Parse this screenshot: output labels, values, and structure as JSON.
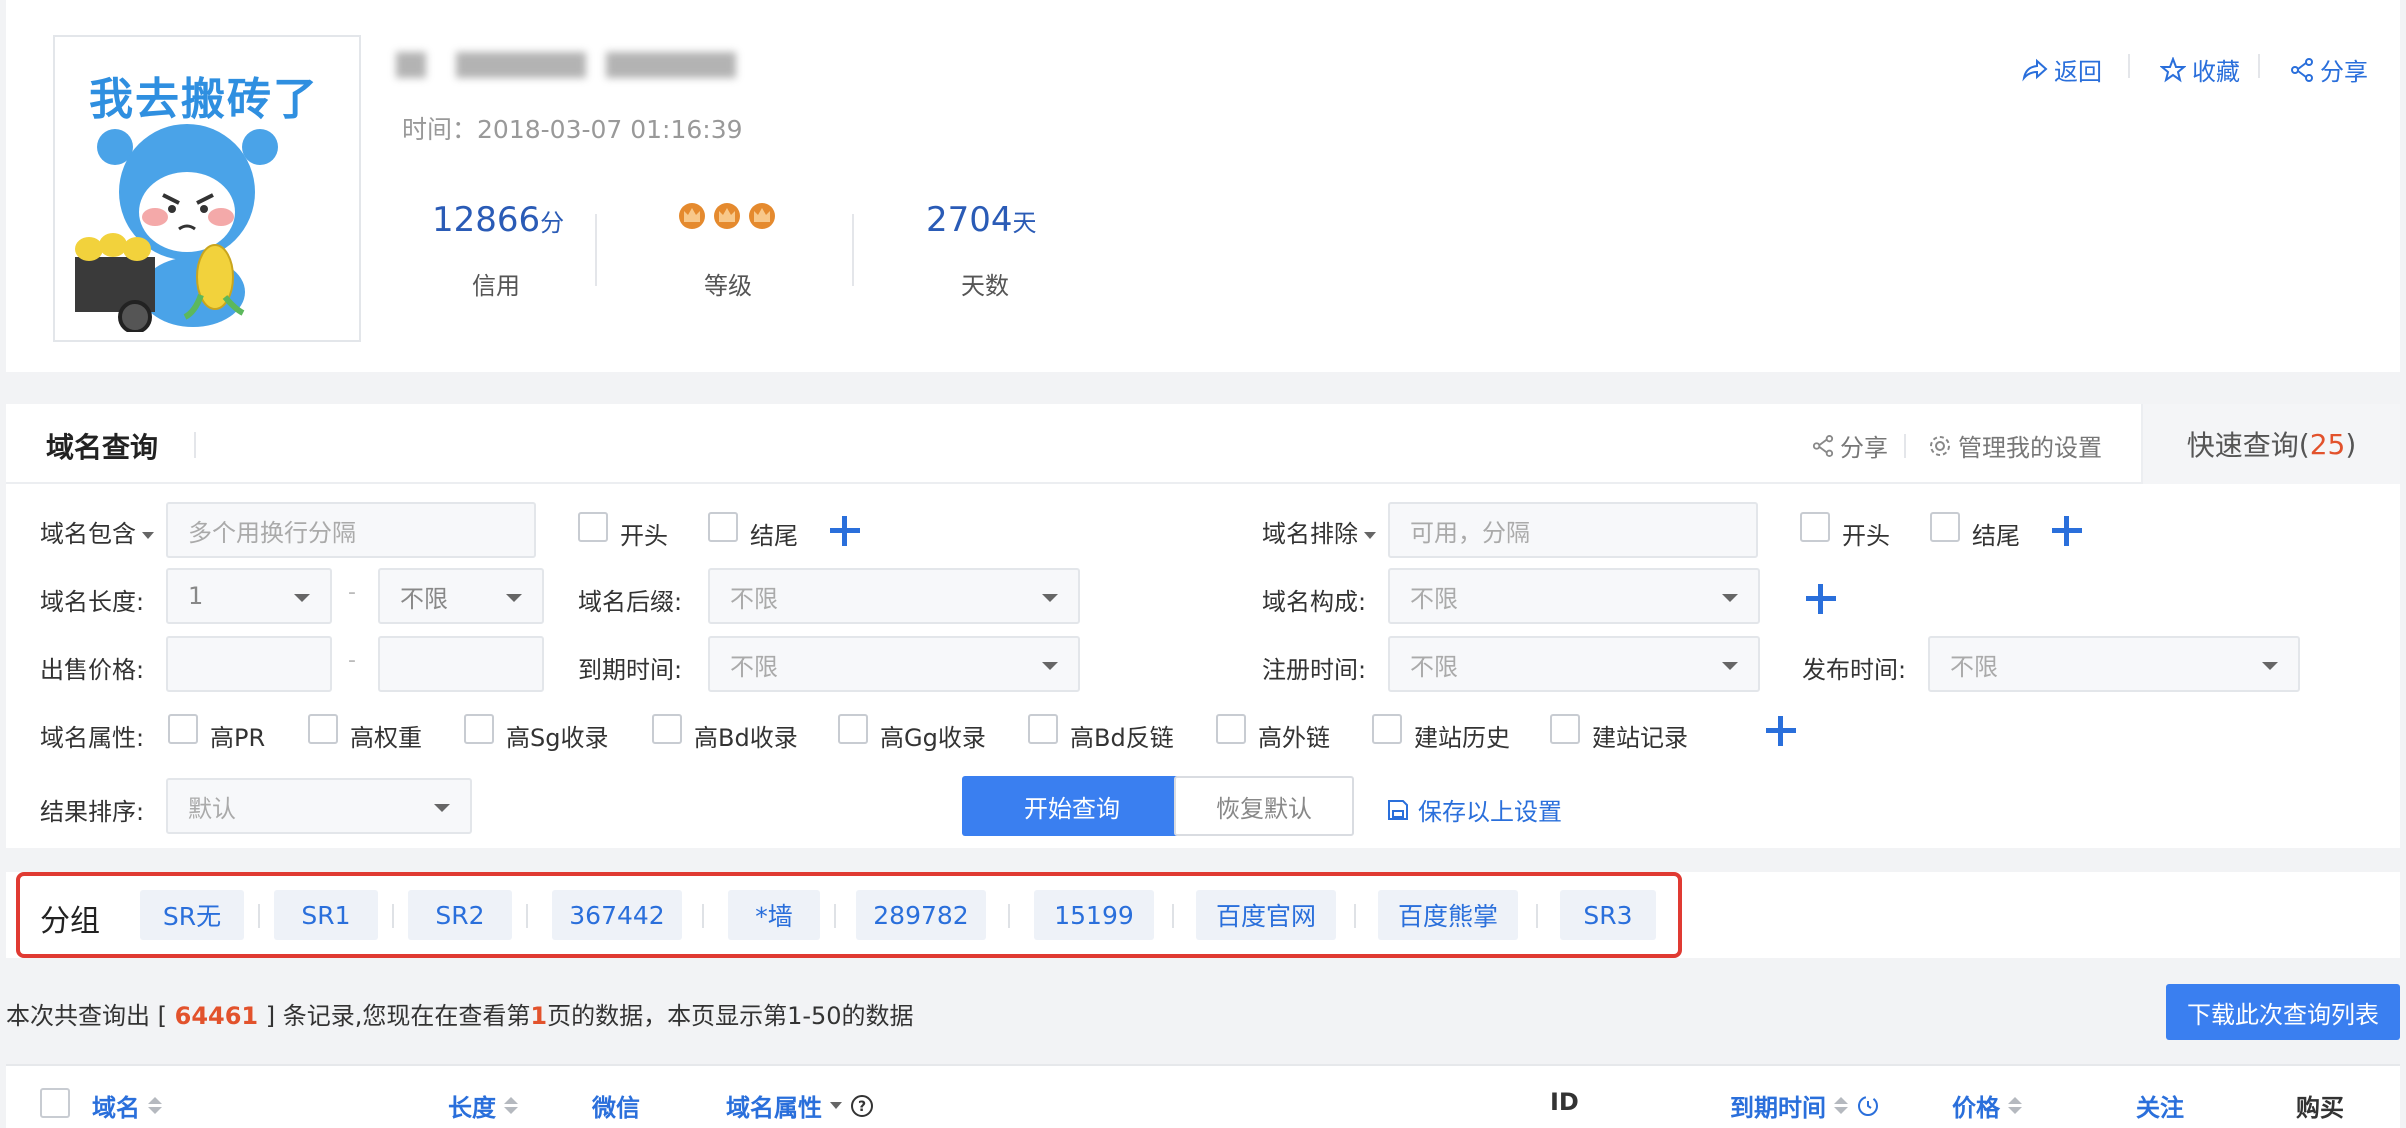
{
  "profile": {
    "avatar_caption": "我去搬砖了",
    "time_label": "时间：",
    "time_value": "2018-03-07 01:16:39",
    "credit_value": "12866",
    "credit_unit": "分",
    "credit_label": "信用",
    "level_label": "等级",
    "level_crowns": 3,
    "days_value": "2704",
    "days_unit": "天",
    "days_label": "天数",
    "actions": {
      "back": "返回",
      "favorite": "收藏",
      "share": "分享"
    }
  },
  "query": {
    "title": "域名查询",
    "share": "分享",
    "manage_settings": "管理我的设置",
    "quick_query_label": "快速查询",
    "quick_query_count": "25",
    "include_label": "域名包含",
    "include_placeholder": "多个用换行分隔",
    "start_label": "开头",
    "end_label": "结尾",
    "exclude_label": "域名排除",
    "exclude_placeholder": "可用，分隔",
    "length_label": "域名长度:",
    "length_min": "1",
    "length_max": "不限",
    "suffix_label": "域名后缀:",
    "suffix_value": "不限",
    "composition_label": "域名构成:",
    "composition_value": "不限",
    "price_label": "出售价格:",
    "expire_label": "到期时间:",
    "expire_value": "不限",
    "register_label": "注册时间:",
    "register_value": "不限",
    "publish_label": "发布时间:",
    "publish_value": "不限",
    "attr_label": "域名属性:",
    "attributes": [
      "高PR",
      "高权重",
      "高Sg收录",
      "高Bd收录",
      "高Gg收录",
      "高Bd反链",
      "高外链",
      "建站历史",
      "建站记录"
    ],
    "sort_label": "结果排序:",
    "sort_value": "默认",
    "range_dash": "-",
    "search_button": "开始查询",
    "reset_button": "恢复默认",
    "save_settings": "保存以上设置"
  },
  "groups": {
    "title": "分组",
    "items": [
      "SR无",
      "SR1",
      "SR2",
      "367442",
      "*墙",
      "289782",
      "15199",
      "百度官网",
      "百度熊掌",
      "SR3"
    ]
  },
  "summary": {
    "prefix": "本次共查询出 [ ",
    "total": "64461",
    "middle": " ] 条记录,您现在在查看第",
    "page": "1",
    "suffix": "页的数据，本页显示第1-50的数据",
    "download_button": "下载此次查询列表"
  },
  "table": {
    "columns": [
      "域名",
      "长度",
      "微信",
      "域名属性",
      "ID",
      "到期时间",
      "价格",
      "关注",
      "购买"
    ]
  },
  "colors": {
    "accent": "#2a6fdb",
    "primary_button": "#3a7ff0",
    "highlight": "#e2522c",
    "group_border": "#e03a32"
  }
}
